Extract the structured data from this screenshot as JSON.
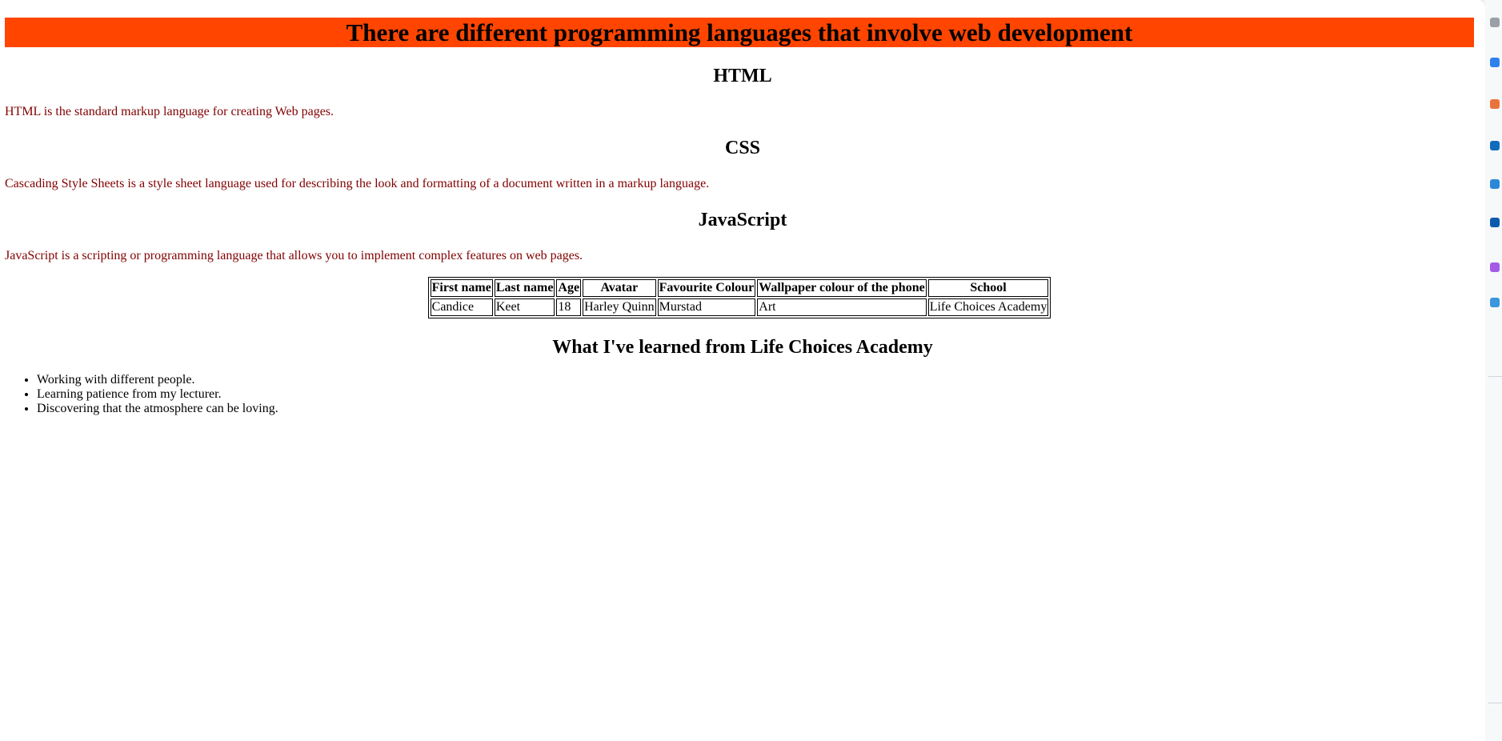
{
  "page": {
    "banner": "There are different programming languages that involve web development",
    "sections": [
      {
        "heading": "HTML",
        "text": "HTML is the standard markup language for creating Web pages."
      },
      {
        "heading": "CSS",
        "text": "Cascading Style Sheets is a style sheet language used for describing the look and formatting of a document written in a markup language."
      },
      {
        "heading": "JavaScript",
        "text": "JavaScript is a scripting or programming language that allows you to implement complex features on web pages."
      }
    ],
    "table": {
      "headers": [
        "First name",
        "Last name",
        "Age",
        "Avatar",
        "Favourite Colour",
        "Wallpaper colour of the phone",
        "School"
      ],
      "rows": [
        [
          "Candice",
          "Keet",
          "18",
          "Harley Quinn",
          "Murstad",
          "Art",
          "Life Choices Academy"
        ]
      ]
    },
    "learned_heading": "What I've learned from Life Choices Academy",
    "learned_items": [
      "Working with different people.",
      "Learning patience from my lecturer.",
      "Discovering that the atmosphere can be loving."
    ]
  },
  "colors": {
    "banner_bg": "#ff4500",
    "desc_text": "#800000"
  },
  "right_rail_icons": [
    "extension-icon",
    "edge-icon",
    "office-icon",
    "outlook-icon",
    "teams-icon",
    "drop-icon",
    "add-icon",
    "settings-icon"
  ]
}
